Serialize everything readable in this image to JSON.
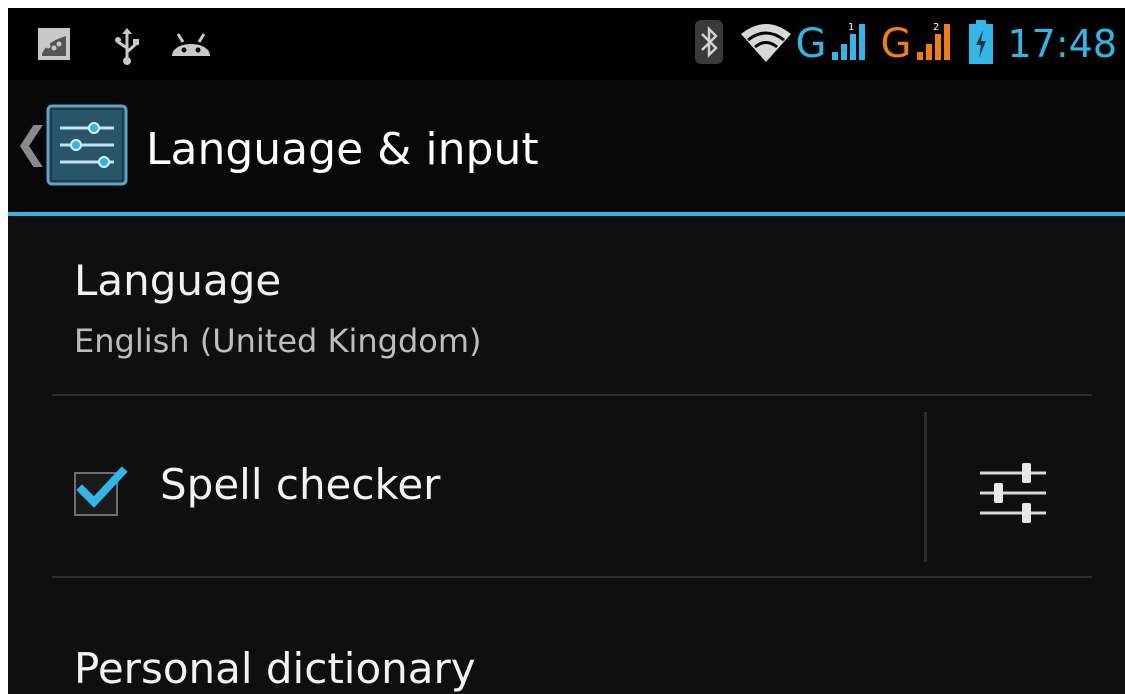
{
  "status_bar": {
    "icons": [
      "gallery-notification-icon",
      "usb-icon",
      "android-debug-icon"
    ],
    "right_icons": [
      "bluetooth-icon",
      "wifi-icon",
      "signal-sim1-icon",
      "signal-sim2-icon",
      "battery-charging-icon"
    ],
    "network_type_sim1": "G",
    "network_type_sim2": "G",
    "time": "17:48",
    "accent_color": "#33b5e5",
    "sim2_color": "#f07c1c"
  },
  "action_bar": {
    "title": "Language & input",
    "icon": "settings-sliders-icon",
    "up_icon": "chevron-left-icon"
  },
  "settings": {
    "language": {
      "title": "Language",
      "summary": "English (United Kingdom)"
    },
    "spell_checker": {
      "title": "Spell checker",
      "checked": true,
      "settings_icon": "sliders-icon"
    },
    "personal_dictionary": {
      "title": "Personal dictionary"
    }
  }
}
